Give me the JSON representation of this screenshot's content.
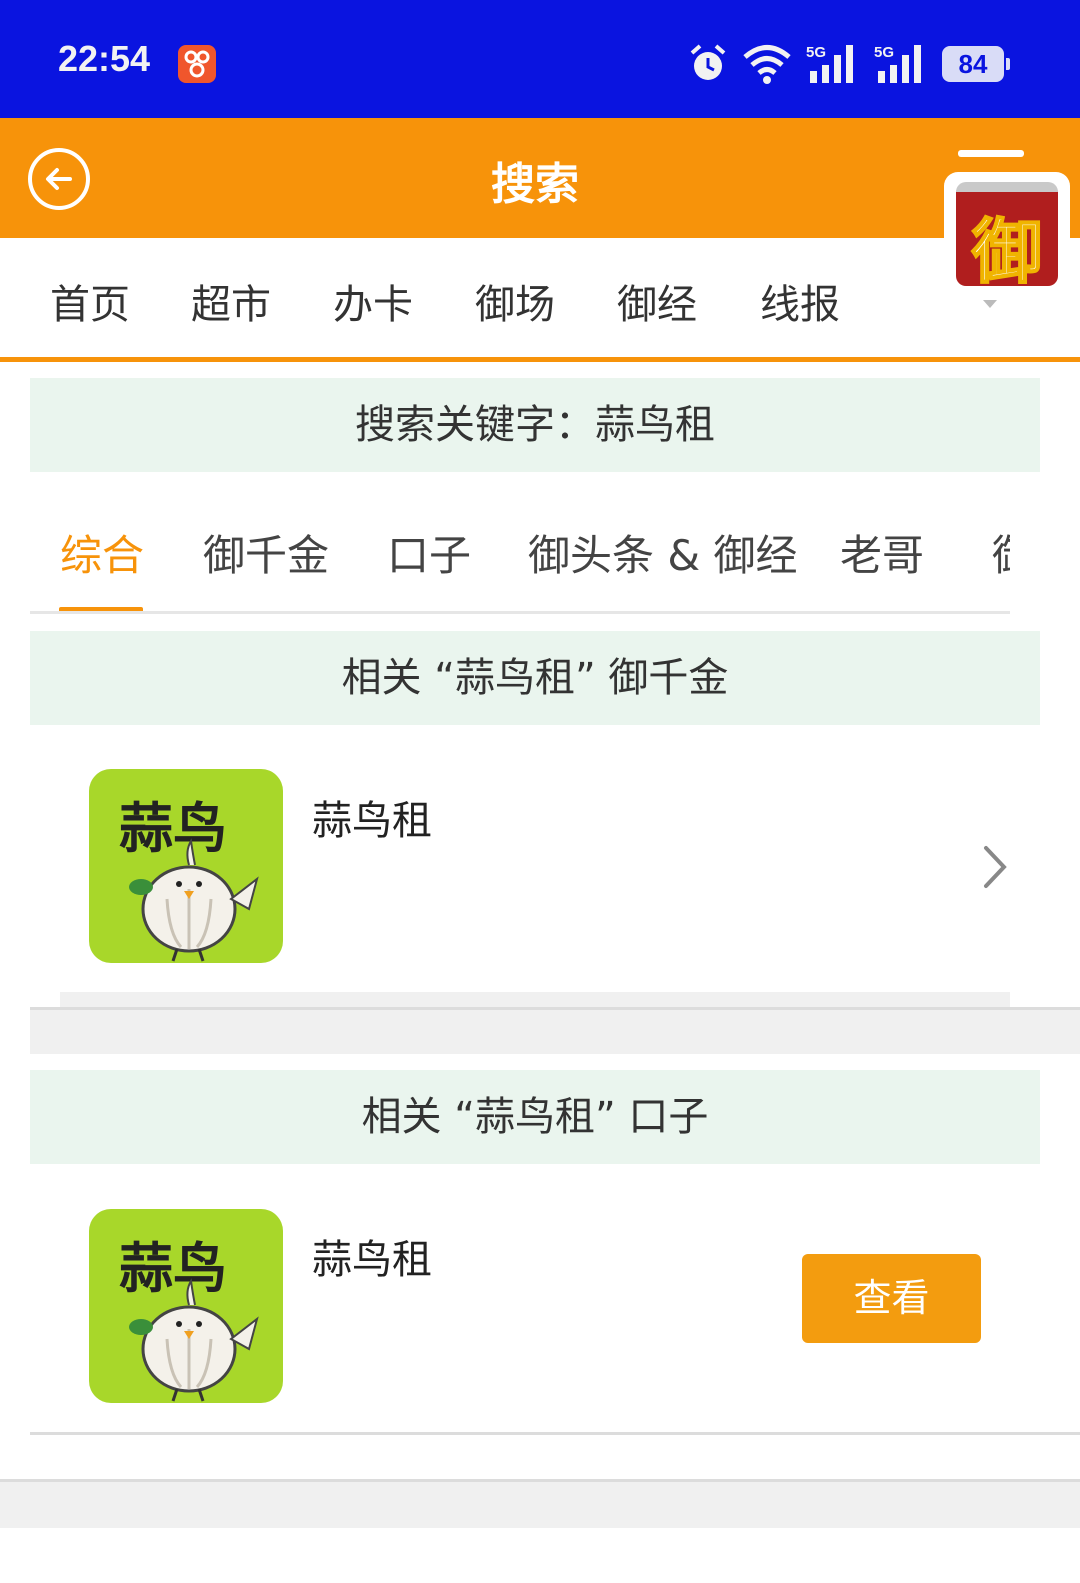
{
  "status": {
    "time": "22:54",
    "battery": "84",
    "net1": "5G",
    "net2": "5G"
  },
  "header": {
    "title": "搜索"
  },
  "logo": {
    "char": "御"
  },
  "nav": {
    "items": [
      "首页",
      "超市",
      "办卡",
      "御场",
      "御经",
      "线报"
    ]
  },
  "search": {
    "keyword_label": "搜索关键字：蒜鸟租"
  },
  "tabs": {
    "items": [
      "综合",
      "御千金",
      "口子",
      "御头条 & 御经",
      "老哥",
      "御"
    ],
    "active": 0
  },
  "sections": [
    {
      "title": "相关 “蒜鸟租” 御千金",
      "item": {
        "name": "蒜鸟租",
        "icon_text": "蒜鸟",
        "icon": "garlic-bird-icon"
      }
    },
    {
      "title": "相关 “蒜鸟租” 口子",
      "item": {
        "name": "蒜鸟租",
        "icon_text": "蒜鸟",
        "icon": "garlic-bird-icon",
        "button": "查看"
      }
    }
  ],
  "colors": {
    "status_bar": "#0a14e0",
    "accent": "#f7930a",
    "section_bg": "#eaf5ee",
    "icon_bg": "#a8d72a"
  }
}
